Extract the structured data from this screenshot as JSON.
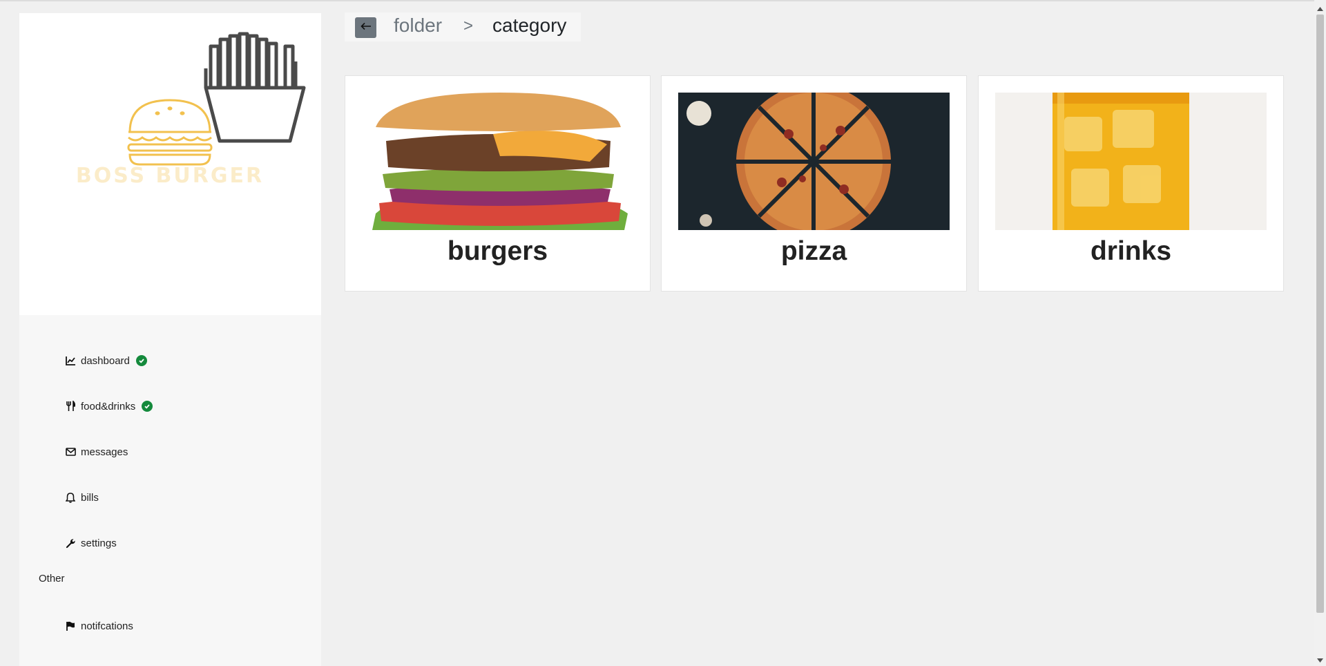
{
  "brand": {
    "name": "BOSS BURGER"
  },
  "breadcrumb": {
    "back_icon": "arrow-left-icon",
    "folder": "folder",
    "separator": ">",
    "current": "category"
  },
  "sidebar": {
    "items": [
      {
        "label": "dashboard",
        "icon": "chart-line-icon",
        "status": "check-circle-icon"
      },
      {
        "label": "food&drinks",
        "icon": "utensils-icon",
        "status": "check-circle-icon"
      },
      {
        "label": "messages",
        "icon": "envelope-icon"
      },
      {
        "label": "bills",
        "icon": "bell-icon"
      },
      {
        "label": "settings",
        "icon": "wrench-icon"
      }
    ],
    "section_label": "Other",
    "other_items": [
      {
        "label": "notifcations",
        "icon": "flag-icon"
      }
    ]
  },
  "categories": [
    {
      "title": "burgers"
    },
    {
      "title": "pizza"
    },
    {
      "title": "drinks"
    }
  ],
  "colors": {
    "accent_gray": "#6c757d",
    "check_green": "#148a3c",
    "logo_yellow": "#f2c14e",
    "logo_dark": "#4a4a4a"
  }
}
